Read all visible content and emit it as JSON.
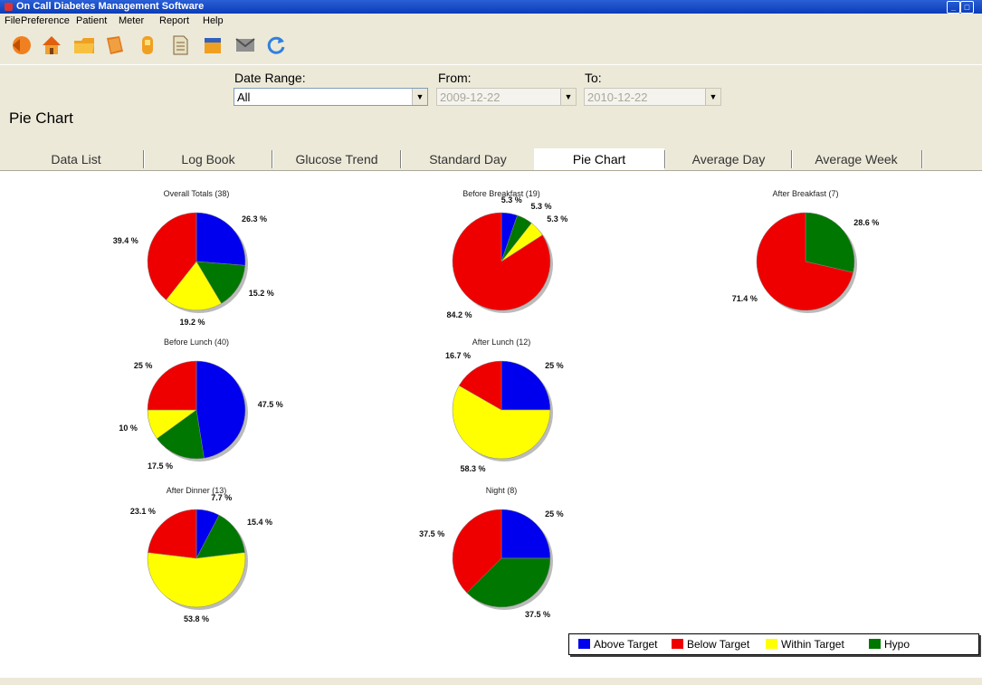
{
  "window": {
    "title": "On Call Diabetes Management Software"
  },
  "menu": [
    "File",
    "Preference",
    "Patient",
    "Meter",
    "Report",
    "Help"
  ],
  "toolbar": [
    "back-icon",
    "home-icon",
    "folder-icon",
    "book-icon",
    "meter-icon",
    "document-icon",
    "notebook-icon",
    "email-icon",
    "refresh-icon"
  ],
  "header": {
    "page_title": "Pie Chart",
    "date_range_label": "Date Range:",
    "date_range_value": "All",
    "from_label": "From:",
    "from_value": "2009-12-22",
    "to_label": "To:",
    "to_value": "2010-12-22"
  },
  "tabs": [
    "Data List",
    "Log Book",
    "Glucose Trend",
    "Standard Day",
    "Pie Chart",
    "Average Day",
    "Average Week"
  ],
  "active_tab": "Pie Chart",
  "colors": {
    "above": "#0000ee",
    "below": "#ee0000",
    "within": "#ffff00",
    "hypo": "#007700"
  },
  "legend": [
    "Above Target",
    "Below Target",
    "Within Target",
    "Hypo"
  ],
  "chart_data": [
    {
      "type": "pie",
      "title": "Overall Totals (38)",
      "slices": [
        {
          "label": "Above Target",
          "value": 26.3,
          "text": "26.3 %"
        },
        {
          "label": "Hypo",
          "value": 15.2,
          "text": "15.2 %"
        },
        {
          "label": "Within Target",
          "value": 19.2,
          "text": "19.2 %"
        },
        {
          "label": "Below Target",
          "value": 39.4,
          "text": "39.4 %"
        }
      ]
    },
    {
      "type": "pie",
      "title": "Before Breakfast (19)",
      "slices": [
        {
          "label": "Above Target",
          "value": 5.3,
          "text": "5.3 %"
        },
        {
          "label": "Hypo",
          "value": 5.3,
          "text": "5.3 %"
        },
        {
          "label": "Within Target",
          "value": 5.3,
          "text": "5.3 %"
        },
        {
          "label": "Below Target",
          "value": 84.2,
          "text": "84.2 %"
        }
      ]
    },
    {
      "type": "pie",
      "title": "After Breakfast (7)",
      "slices": [
        {
          "label": "Hypo",
          "value": 28.6,
          "text": "28.6 %"
        },
        {
          "label": "Below Target",
          "value": 71.4,
          "text": "71.4 %"
        }
      ]
    },
    {
      "type": "pie",
      "title": "Before Lunch (40)",
      "slices": [
        {
          "label": "Above Target",
          "value": 47.5,
          "text": "47.5 %"
        },
        {
          "label": "Hypo",
          "value": 17.5,
          "text": "17.5 %"
        },
        {
          "label": "Within Target",
          "value": 10,
          "text": "10 %"
        },
        {
          "label": "Below Target",
          "value": 25,
          "text": "25 %"
        }
      ]
    },
    {
      "type": "pie",
      "title": "After Lunch (12)",
      "slices": [
        {
          "label": "Above Target",
          "value": 25,
          "text": "25 %"
        },
        {
          "label": "Within Target",
          "value": 58.3,
          "text": "58.3 %"
        },
        {
          "label": "Below Target",
          "value": 16.7,
          "text": "16.7 %"
        }
      ]
    },
    {
      "type": "pie",
      "title": "After Dinner (13)",
      "slices": [
        {
          "label": "Above Target",
          "value": 7.7,
          "text": "7.7 %"
        },
        {
          "label": "Hypo",
          "value": 15.4,
          "text": "15.4 %"
        },
        {
          "label": "Within Target",
          "value": 53.8,
          "text": "53.8 %"
        },
        {
          "label": "Below Target",
          "value": 23.1,
          "text": "23.1 %"
        }
      ]
    },
    {
      "type": "pie",
      "title": "Night (8)",
      "slices": [
        {
          "label": "Above Target",
          "value": 25,
          "text": "25 %"
        },
        {
          "label": "Hypo",
          "value": 37.5,
          "text": "37.5 %"
        },
        {
          "label": "Below Target",
          "value": 37.5,
          "text": "37.5 %"
        }
      ]
    }
  ]
}
